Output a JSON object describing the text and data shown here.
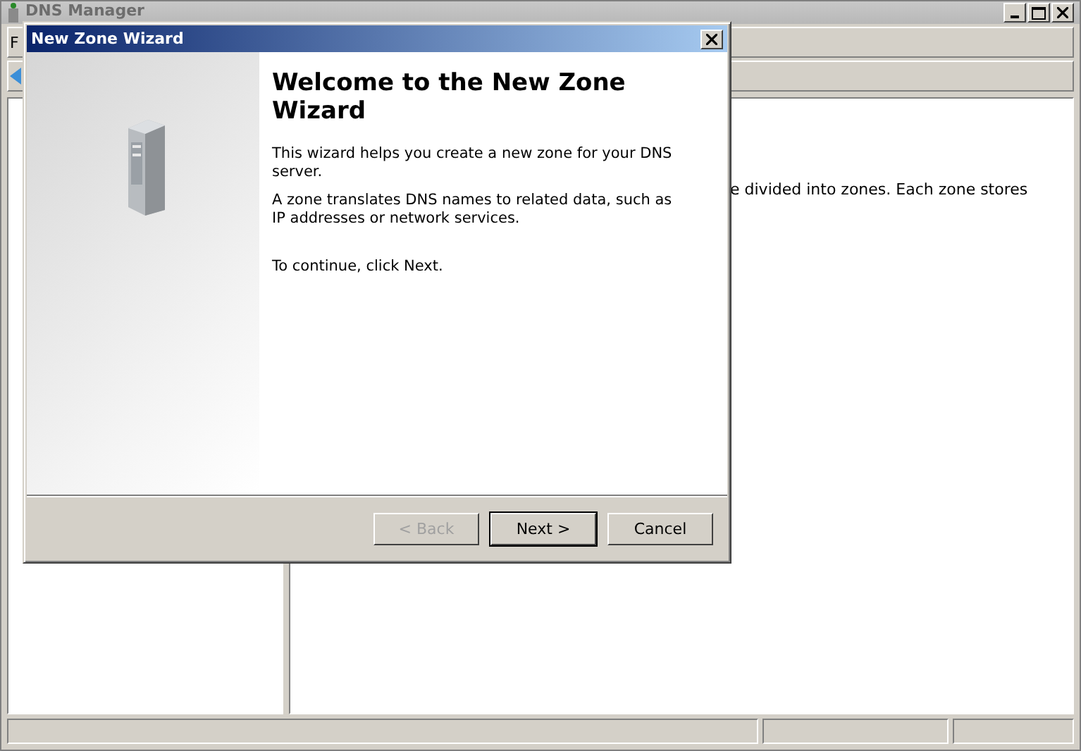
{
  "window": {
    "title": "DNS Manager"
  },
  "menu": [
    {
      "label": "F"
    }
  ],
  "details_pane": {
    "text": "e divided into zones. Each zone stores"
  },
  "dialog": {
    "title": "New Zone Wizard",
    "heading": "Welcome to the New Zone Wizard",
    "paragraphs": [
      "This wizard helps you create a new zone for your DNS server.",
      "A zone translates DNS names to related data, such as IP addresses or network services.",
      "To continue, click Next."
    ],
    "buttons": [
      {
        "label": "< Back",
        "disabled": true,
        "default": false
      },
      {
        "label": "Next >",
        "disabled": false,
        "default": true
      },
      {
        "label": "Cancel",
        "disabled": false,
        "default": false
      }
    ]
  }
}
